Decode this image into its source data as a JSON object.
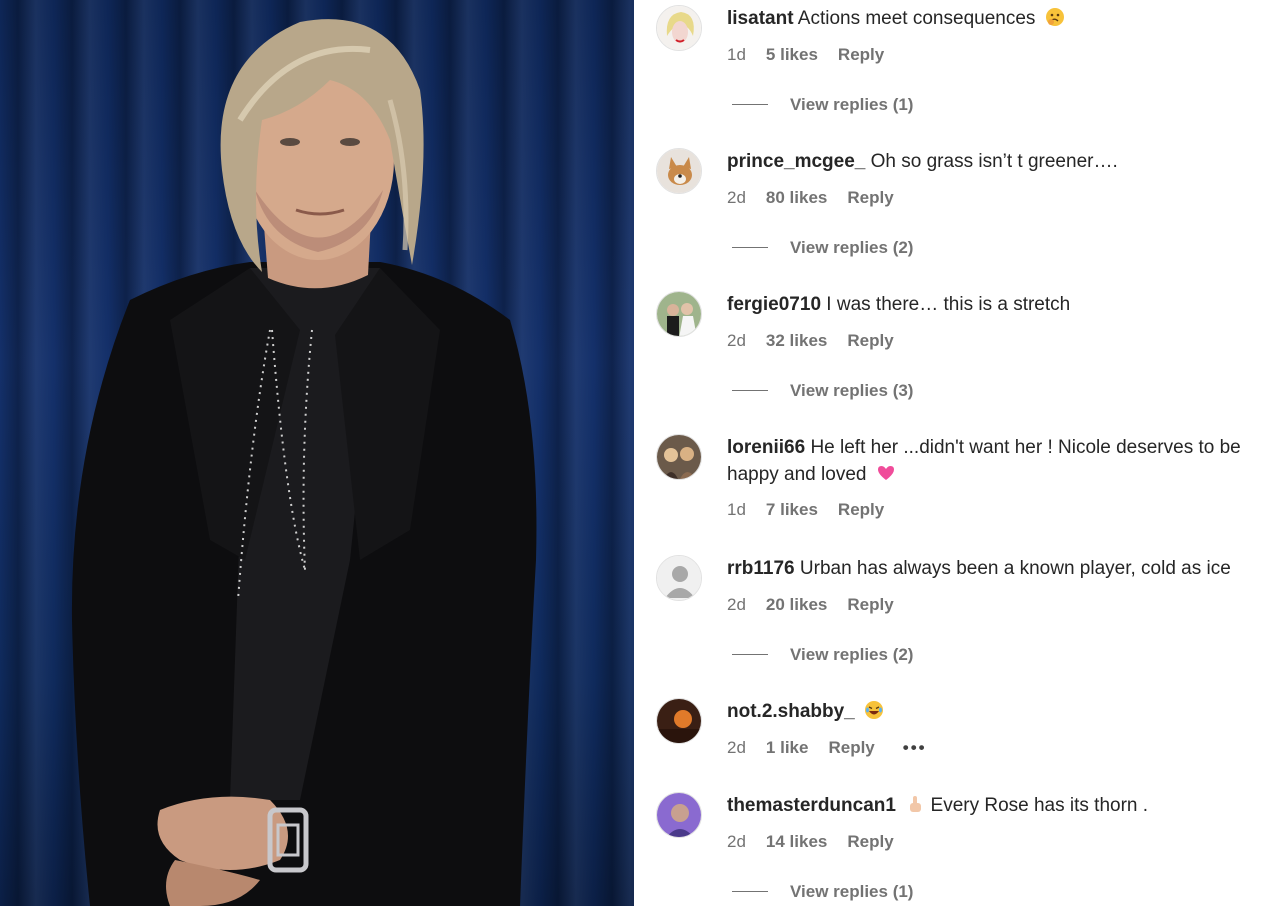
{
  "comments": [
    {
      "username": "lisatant",
      "text": "Actions meet consequences",
      "emoji": "thinking-face-emoji",
      "time": "1d",
      "likes": "5 likes",
      "reply": "Reply",
      "view_replies": "View replies (1)"
    },
    {
      "username": "prince_mcgee_",
      "text": "Oh so grass isn’t t greener….",
      "time": "2d",
      "likes": "80 likes",
      "reply": "Reply",
      "view_replies": "View replies (2)"
    },
    {
      "username": "fergie0710",
      "text": "I was there… this is a stretch",
      "time": "2d",
      "likes": "32 likes",
      "reply": "Reply",
      "view_replies": "View replies (3)"
    },
    {
      "username": "lorenii66",
      "text": "He left her ...didn't want her ! Nicole deserves to be happy and loved",
      "emoji": "pink-heart-emoji",
      "time": "1d",
      "likes": "7 likes",
      "reply": "Reply"
    },
    {
      "username": "rrb1176",
      "text": "Urban has always been a known player, cold as ice",
      "time": "2d",
      "likes": "20 likes",
      "reply": "Reply",
      "view_replies": "View replies (2)"
    },
    {
      "username": "not.2.shabby_",
      "text": "",
      "emoji": "laughing-face-emoji",
      "time": "2d",
      "likes": "1 like",
      "reply": "Reply",
      "more": "•••"
    },
    {
      "username": "themasterduncan1",
      "text": "Every Rose has its thorn .",
      "emoji": "pointing-up-emoji",
      "time": "2d",
      "likes": "14 likes",
      "reply": "Reply",
      "view_replies": "View replies (1)"
    }
  ],
  "colors": {
    "text": "#262626",
    "secondary": "#737373",
    "curtain": "#14306a"
  }
}
